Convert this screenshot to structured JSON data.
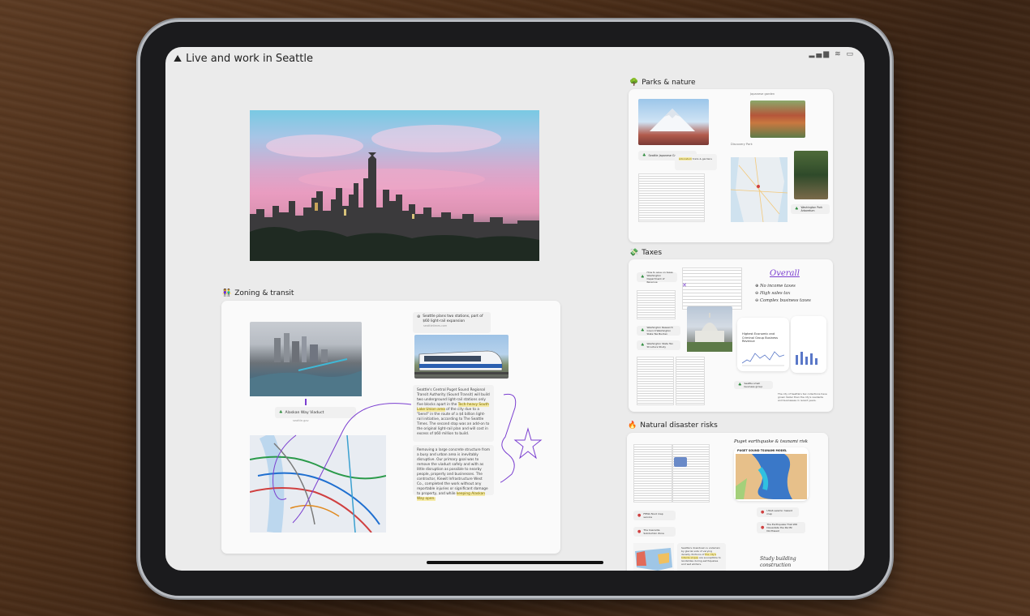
{
  "status_bar": {
    "icons": "▂▄▆ ≋ ▭"
  },
  "board": {
    "title": "Live and work in Seattle",
    "title_icon": "mountain-emoji"
  },
  "sections": {
    "zoning": {
      "title": "Zoning & transit",
      "icon": "people-emoji",
      "chip_viaduct": "Alaskan Way Viaduct",
      "chip_viaduct_sub": "seattle.gov",
      "news_title": "Seattle plans two stations, part of $60 light-rail expansion",
      "news_source": "seattletimes.com",
      "note1_a": "Seattle's Central Puget Sound Regional Transit Authority (Sound Transit) will build two underground light-rail stations only five blocks apart in the ",
      "note1_hl": "Tech-heavy South Lake Union area",
      "note1_b": " of the city due to a \"bend\" in the route of a $4 billion light-rail initiative, according to The Seattle Times. The second stop was an add-on to the original light-rail plan and will cost in excess of $60 million to build.",
      "note2_a": "Removing a large concrete structure from a busy and urban area is inevitably disruptive. Our primary goal was to remove the viaduct safely and with as little disruption as possible to nearby people, property and businesses. The contractor, Kiewit Infrastructure West Co., completed the work without any reportable injuries or significant damage to property, and while ",
      "note2_hl": "keeping Alaskan Way open."
    },
    "parks": {
      "title": "Parks & nature",
      "icon": "tree-emoji",
      "label_a": "Discovery Park",
      "label_b": "Japanese garden",
      "chip_a": "Seattle Japanese Garden Park",
      "chip_b": "Washington Park Arboretum"
    },
    "taxes": {
      "title": "Taxes",
      "icon": "money-emoji",
      "overall": "Overall",
      "line1": "No income taxes",
      "line2": "High sales tax",
      "line3": "Complex business taxes",
      "chip_a": "How to save on taxes Washington Department of Revenue",
      "chip_b": "Washington Research Council Washington State Tax Burden",
      "chip_c": "Washington State Tax Structure Study",
      "chip_d": "Seattle small business group",
      "report_title": "Highest Economic and Criminal Group Business Revenue",
      "foot_note": "The city of Seattle's tax collections have grown faster than the city's residents and businesses in recent years."
    },
    "disaster": {
      "title": "Natural disaster risks",
      "icon": "fire-emoji",
      "map_title": "PUGET SOUND TSUNAMI MODEL",
      "hand_a": "Puget earthquake & tsunami risk",
      "hand_b": "Study building construction",
      "chip_a": "FEMA flood map service",
      "chip_b": "The Cascadia Subduction Zone",
      "chip_c": "USGS seismic hazard map",
      "chip_d": "The Earthquake That Will Devastate the Pacific Northwest",
      "note_a": "Seattle's downtown is underlain by glacial soils of varying density. Portions of ",
      "note_hl": "the city's hillside slopes",
      "note_b": " are susceptible to landslides during earthquakes and wet winters."
    }
  },
  "colors": {
    "ink_purple": "#7b3fd0",
    "highlight": "#f5eaa6",
    "canvas": "#ebebeb"
  }
}
